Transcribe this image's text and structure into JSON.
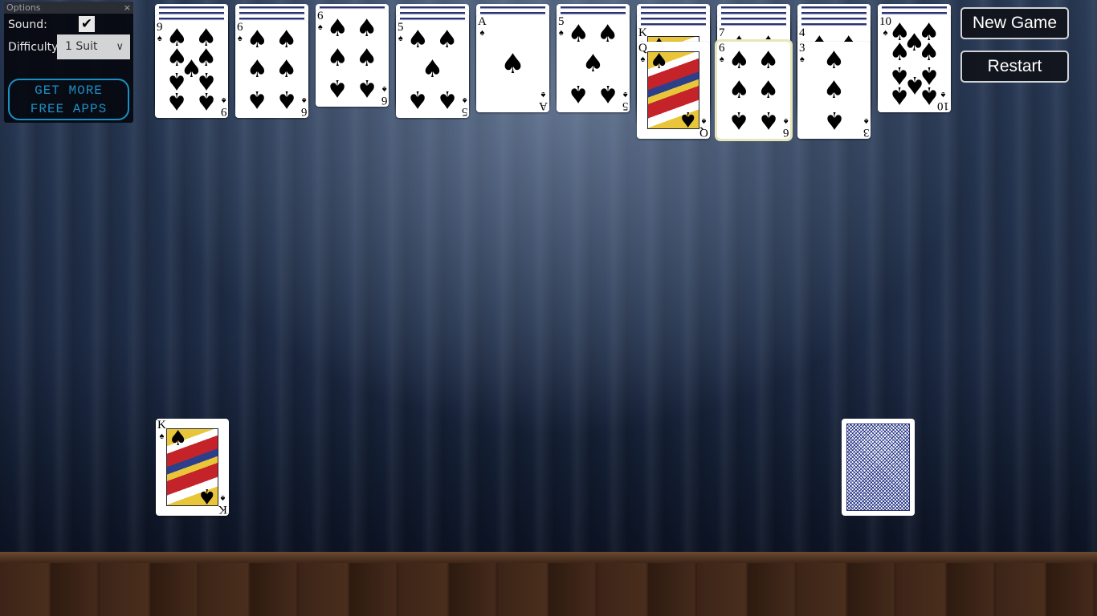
{
  "options": {
    "title": "Options",
    "close_icon": "×",
    "sound_label": "Sound:",
    "sound_checked": true,
    "check_mark": "✔",
    "difficulty_label": "Difficulty:",
    "difficulty_value": "1 Suit",
    "chevron": "⌄",
    "promo_line1": "GET MORE",
    "promo_line2": "FREE APPS"
  },
  "buttons": {
    "new_game": "New Game",
    "restart": "Restart"
  },
  "tableau": [
    {
      "face_down": 3,
      "face_up": [
        {
          "rank": "9",
          "suit": "♠"
        }
      ]
    },
    {
      "face_down": 3,
      "face_up": [
        {
          "rank": "6",
          "suit": "♠"
        }
      ]
    },
    {
      "face_down": 1,
      "face_up": [
        {
          "rank": "6",
          "suit": "♠"
        }
      ]
    },
    {
      "face_down": 3,
      "face_up": [
        {
          "rank": "5",
          "suit": "♠"
        }
      ]
    },
    {
      "face_down": 2,
      "face_up": [
        {
          "rank": "A",
          "suit": "♠"
        }
      ]
    },
    {
      "face_down": 2,
      "face_up": [
        {
          "rank": "5",
          "suit": "♠"
        }
      ]
    },
    {
      "face_down": 4,
      "face_up": [
        {
          "rank": "K",
          "suit": "♠"
        },
        {
          "rank": "Q",
          "suit": "♠"
        }
      ]
    },
    {
      "face_down": 4,
      "face_up": [
        {
          "rank": "7",
          "suit": "♠"
        },
        {
          "rank": "6",
          "suit": "♠",
          "selected": true
        }
      ]
    },
    {
      "face_down": 4,
      "face_up": [
        {
          "rank": "4",
          "suit": "♠"
        },
        {
          "rank": "3",
          "suit": "♠"
        }
      ]
    },
    {
      "face_down": 2,
      "face_up": [
        {
          "rank": "10",
          "suit": "♠"
        }
      ]
    }
  ],
  "foundation": [
    {
      "rank": "K",
      "suit": "♠"
    }
  ],
  "stock": {
    "pattern": "blue-lattice-card-back"
  },
  "colors": {
    "promo": "#1b8fc4",
    "selected_highlight": "#e8e6b8",
    "card_back": "#2b3370"
  }
}
